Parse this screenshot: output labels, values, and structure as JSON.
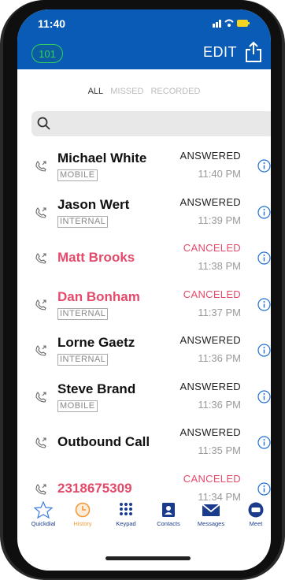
{
  "status_bar": {
    "time": "11:40",
    "icons": "▮▮▮ ◠ ⚡"
  },
  "header": {
    "extension": "101",
    "edit_label": "EDIT",
    "share_icon": "share-icon"
  },
  "filters": {
    "items": [
      "ALL",
      "MISSED",
      "RECORDED"
    ],
    "active": "ALL"
  },
  "search": {
    "placeholder": ""
  },
  "calls": [
    {
      "name": "Michael White",
      "tag": "MOBILE",
      "status": "ANSWERED",
      "time": "11:40 PM",
      "missed": false
    },
    {
      "name": "Jason Wert",
      "tag": "INTERNAL",
      "status": "ANSWERED",
      "time": "11:39 PM",
      "missed": false
    },
    {
      "name": "Matt Brooks",
      "tag": "",
      "status": "CANCELED",
      "time": "11:38 PM",
      "missed": true
    },
    {
      "name": "Dan Bonham",
      "tag": "INTERNAL",
      "status": "CANCELED",
      "time": "11:37 PM",
      "missed": true
    },
    {
      "name": "Lorne Gaetz",
      "tag": "INTERNAL",
      "status": "ANSWERED",
      "time": "11:36 PM",
      "missed": false
    },
    {
      "name": "Steve Brand",
      "tag": "MOBILE",
      "status": "ANSWERED",
      "time": "11:36 PM",
      "missed": false
    },
    {
      "name": "Outbound Call",
      "tag": "",
      "status": "ANSWERED",
      "time": "11:35 PM",
      "missed": false
    },
    {
      "name": "2318675309",
      "tag": "",
      "status": "CANCELED",
      "time": "11:34 PM",
      "missed": true
    }
  ],
  "tabs": [
    {
      "label": "Quickdial",
      "icon": "star-icon"
    },
    {
      "label": "History",
      "icon": "clock-icon",
      "active": true
    },
    {
      "label": "Keypad",
      "icon": "keypad-icon"
    },
    {
      "label": "Contacts",
      "icon": "contact-card-icon"
    },
    {
      "label": "Messages",
      "icon": "envelope-icon"
    },
    {
      "label": "Meet",
      "icon": "chat-bubble-icon"
    }
  ],
  "colors": {
    "header": "#0a5bb5",
    "accent_green": "#32d060",
    "missed_red": "#e34a6b",
    "tab_blue": "#1a3a8c",
    "tab_active": "#f29a3a"
  }
}
